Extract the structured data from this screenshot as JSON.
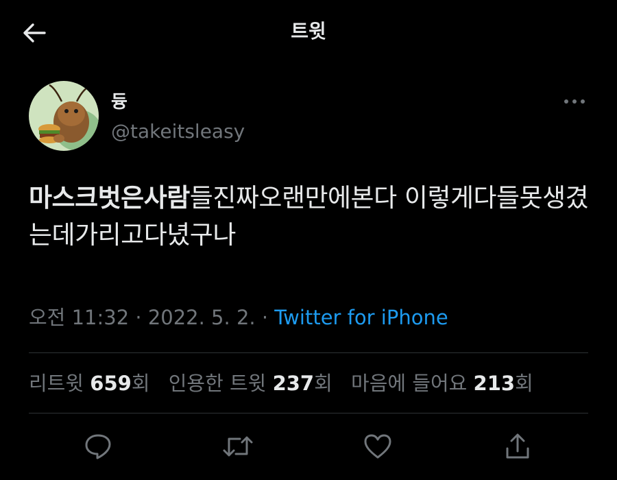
{
  "header": {
    "title": "트윗",
    "back_icon": "arrow-left-icon"
  },
  "author": {
    "display_name": "듕",
    "handle": "@takeitsleasy",
    "more_icon": "more-horizontal-icon"
  },
  "tweet": {
    "text_bold": "마스크벗은사람",
    "text_rest": "들진짜오랜만에본다 이렇게다들못생겼는데가리고다녔구나"
  },
  "meta": {
    "time": "오전 11:32",
    "separator": "·",
    "date": "2022. 5. 2.",
    "source": "Twitter for iPhone"
  },
  "stats": {
    "retweets_label": "리트윗",
    "retweets_count": "659",
    "retweets_suffix": "회",
    "quotes_label": "인용한 트윗",
    "quotes_count": "237",
    "quotes_suffix": "회",
    "likes_label": "마음에 들어요",
    "likes_count": "213",
    "likes_suffix": "회"
  },
  "actions": {
    "reply_icon": "reply-icon",
    "retweet_icon": "retweet-icon",
    "like_icon": "heart-icon",
    "share_icon": "share-icon"
  },
  "colors": {
    "background": "#000000",
    "text": "#e7e9ea",
    "secondary": "#71767b",
    "link": "#1d9bf0",
    "divider": "#2f3336"
  }
}
